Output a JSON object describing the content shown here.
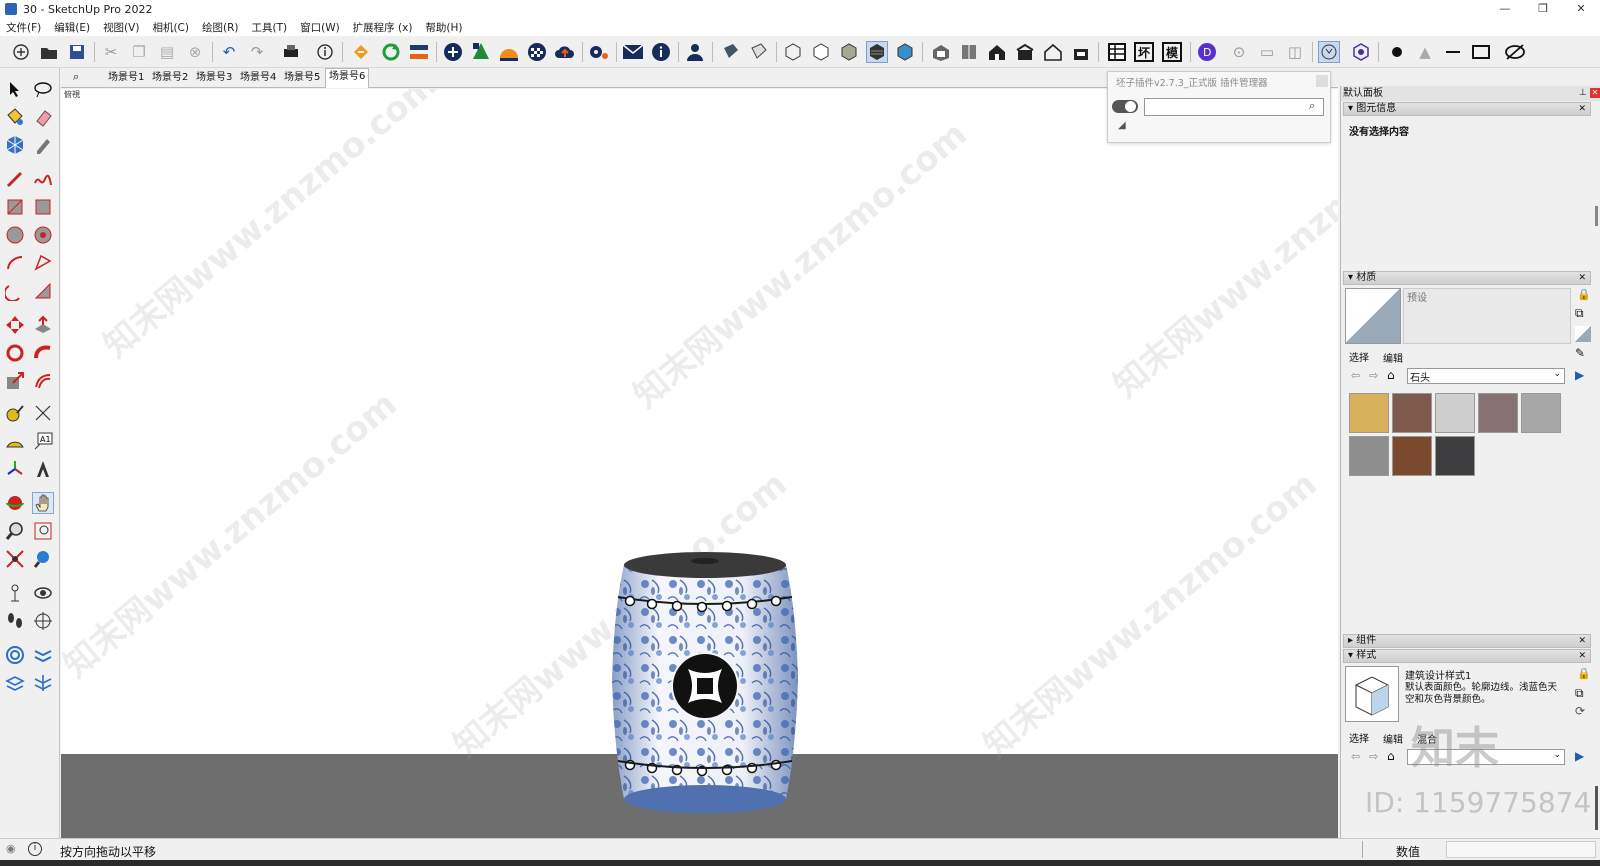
{
  "window": {
    "title": "30 - SketchUp Pro 2022",
    "controls": [
      "—",
      "❐",
      "✕"
    ]
  },
  "menu": [
    "文件(F)",
    "编辑(E)",
    "视图(V)",
    "相机(C)",
    "绘图(R)",
    "工具(T)",
    "窗口(W)",
    "扩展程序 (x)",
    "帮助(H)"
  ],
  "scene_tabs": [
    "场景号1",
    "场景号2",
    "场景号3",
    "场景号4",
    "场景号5",
    "场景号6"
  ],
  "viewport": {
    "corner_label": "俯視",
    "watermark": "知末网www.znzmo.com"
  },
  "plugin_manager": {
    "title": "坯子插件v2.7.3_正式版 插件管理器",
    "search_placeholder": ""
  },
  "panel": {
    "title": "默认面板",
    "entity_info": {
      "header": "图元信息",
      "text": "没有选择内容"
    },
    "materials": {
      "header": "材质",
      "name": "预设",
      "tab_select": "选择",
      "tab_edit": "编辑",
      "library": "石头",
      "swatch_colors": [
        "#d8b15c",
        "#7d5a4c",
        "#cfcfcf",
        "#867272",
        "#a7a7a7",
        "#8e8e8e",
        "#7b4a2c",
        "#3e3e40"
      ]
    },
    "components": {
      "header": "组件"
    },
    "styles": {
      "header": "样式",
      "name": "建筑设计样式1",
      "description": "默认表面颜色。轮廓边线。浅蓝色天空和灰色背景颜色。",
      "tab_select": "选择",
      "tab_edit": "编辑",
      "tab_mix": "混合"
    }
  },
  "status": {
    "hint": "按方向拖动以平移",
    "value_label": "数值"
  },
  "overlay": {
    "logo": "知末",
    "id": "ID: 1159775874"
  }
}
